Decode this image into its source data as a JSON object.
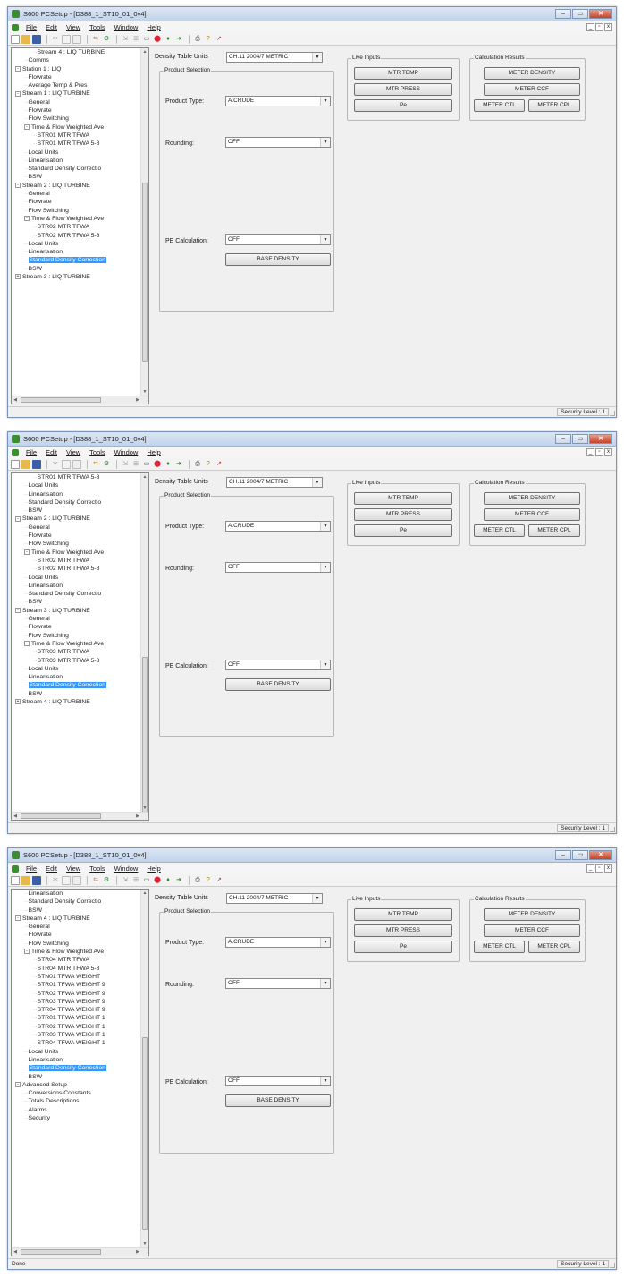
{
  "app": {
    "title": "S600 PCSetup - [D388_1_ST10_01_0v4]",
    "menus": [
      "File",
      "Edit",
      "View",
      "Tools",
      "Window",
      "Help"
    ],
    "caption_buttons": {
      "min": "–",
      "max": "▭",
      "close": "✕"
    },
    "mdi_buttons": {
      "min": "_",
      "restore": "▫",
      "close": "x"
    }
  },
  "form": {
    "density_table_units_label": "Density Table Units",
    "density_table_units_value": "CH.11 2004/7 METRIC",
    "product_selection_label": "Product Selection",
    "product_type_label": "Product Type:",
    "product_type_value": "A.CRUDE",
    "rounding_label": "Rounding:",
    "rounding_value": "OFF",
    "pe_calc_label": "PE Calculation:",
    "pe_calc_value": "OFF",
    "base_density_button": "BASE DENSITY",
    "live_inputs_label": "Live Inputs",
    "mtr_temp": "MTR TEMP",
    "mtr_press": "MTR PRESS",
    "pe": "Pe",
    "calc_results_label": "Calculation Results",
    "meter_density": "METER DENSITY",
    "meter_ccf": "METER CCF",
    "meter_ctl": "METER CTL",
    "meter_cpl": "METER CPL"
  },
  "status": {
    "security": "Security Level : 1",
    "done": "Done"
  },
  "panels": [
    {
      "tree": [
        {
          "t": "Stream 4 : LIQ TURBINE",
          "lvl": 2
        },
        {
          "t": "Comms",
          "lvl": 1
        },
        {
          "t": "Station 1 : LIQ",
          "lvl": 0,
          "exp": "-"
        },
        {
          "t": "Flowrate",
          "lvl": 1
        },
        {
          "t": "Average Temp & Pres",
          "lvl": 1
        },
        {
          "t": "Stream 1 : LIQ TURBINE",
          "lvl": 0,
          "exp": "-"
        },
        {
          "t": "General",
          "lvl": 1
        },
        {
          "t": "Flowrate",
          "lvl": 1
        },
        {
          "t": "Flow Switching",
          "lvl": 1
        },
        {
          "t": "Time & Flow Weighted Ave",
          "lvl": 1,
          "exp": "-"
        },
        {
          "t": "STR01 MTR TFWA",
          "lvl": 2
        },
        {
          "t": "STR01 MTR TFWA 5-8",
          "lvl": 2
        },
        {
          "t": "Local Units",
          "lvl": 1
        },
        {
          "t": "Linearisation",
          "lvl": 1
        },
        {
          "t": "Standard Density Correctio",
          "lvl": 1
        },
        {
          "t": "BSW",
          "lvl": 1
        },
        {
          "t": "Stream 2 : LIQ TURBINE",
          "lvl": 0,
          "exp": "-"
        },
        {
          "t": "General",
          "lvl": 1
        },
        {
          "t": "Flowrate",
          "lvl": 1
        },
        {
          "t": "Flow Switching",
          "lvl": 1
        },
        {
          "t": "Time & Flow Weighted Ave",
          "lvl": 1,
          "exp": "-"
        },
        {
          "t": "STR02 MTR TFWA",
          "lvl": 2
        },
        {
          "t": "STR02 MTR TFWA 5-8",
          "lvl": 2
        },
        {
          "t": "Local Units",
          "lvl": 1
        },
        {
          "t": "Linearisation",
          "lvl": 1
        },
        {
          "t": "Standard Density Correction",
          "lvl": 1,
          "sel": true
        },
        {
          "t": "BSW",
          "lvl": 1
        },
        {
          "t": "Stream 3 : LIQ TURBINE",
          "lvl": 0,
          "exp": "+"
        }
      ]
    },
    {
      "tree": [
        {
          "t": "STR01 MTR TFWA 5-8",
          "lvl": 2
        },
        {
          "t": "Local Units",
          "lvl": 1
        },
        {
          "t": "Linearisation",
          "lvl": 1
        },
        {
          "t": "Standard Density Correctio",
          "lvl": 1
        },
        {
          "t": "BSW",
          "lvl": 1
        },
        {
          "t": "Stream 2 : LIQ TURBINE",
          "lvl": 0,
          "exp": "-"
        },
        {
          "t": "General",
          "lvl": 1
        },
        {
          "t": "Flowrate",
          "lvl": 1
        },
        {
          "t": "Flow Switching",
          "lvl": 1
        },
        {
          "t": "Time & Flow Weighted Ave",
          "lvl": 1,
          "exp": "-"
        },
        {
          "t": "STR02 MTR TFWA",
          "lvl": 2
        },
        {
          "t": "STR02 MTR TFWA 5-8",
          "lvl": 2
        },
        {
          "t": "Local Units",
          "lvl": 1
        },
        {
          "t": "Linearisation",
          "lvl": 1
        },
        {
          "t": "Standard Density Correctio",
          "lvl": 1
        },
        {
          "t": "BSW",
          "lvl": 1
        },
        {
          "t": "Stream 3 : LIQ TURBINE",
          "lvl": 0,
          "exp": "-"
        },
        {
          "t": "General",
          "lvl": 1
        },
        {
          "t": "Flowrate",
          "lvl": 1
        },
        {
          "t": "Flow Switching",
          "lvl": 1
        },
        {
          "t": "Time & Flow Weighted Ave",
          "lvl": 1,
          "exp": "-"
        },
        {
          "t": "STR03 MTR TFWA",
          "lvl": 2
        },
        {
          "t": "STR03 MTR TFWA 5-8",
          "lvl": 2
        },
        {
          "t": "Local Units",
          "lvl": 1
        },
        {
          "t": "Linearisation",
          "lvl": 1
        },
        {
          "t": "Standard Density Correction",
          "lvl": 1,
          "sel": true
        },
        {
          "t": "BSW",
          "lvl": 1
        },
        {
          "t": "Stream 4 : LIQ TURBINE",
          "lvl": 0,
          "exp": "+"
        }
      ]
    },
    {
      "tree": [
        {
          "t": "Linearisation",
          "lvl": 1
        },
        {
          "t": "Standard Density Correctio",
          "lvl": 1
        },
        {
          "t": "BSW",
          "lvl": 1
        },
        {
          "t": "Stream 4 : LIQ TURBINE",
          "lvl": 0,
          "exp": "-"
        },
        {
          "t": "General",
          "lvl": 1
        },
        {
          "t": "Flowrate",
          "lvl": 1
        },
        {
          "t": "Flow Switching",
          "lvl": 1
        },
        {
          "t": "Time & Flow Weighted Ave",
          "lvl": 1,
          "exp": "-"
        },
        {
          "t": "STR04 MTR TFWA",
          "lvl": 2
        },
        {
          "t": "STR04 MTR TFWA 5-8",
          "lvl": 2
        },
        {
          "t": "STN01 TFWA WEIGHT",
          "lvl": 2
        },
        {
          "t": "STR01 TFWA WEIGHT 9",
          "lvl": 2
        },
        {
          "t": "STR02 TFWA WEIGHT 9",
          "lvl": 2
        },
        {
          "t": "STR03 TFWA WEIGHT 9",
          "lvl": 2
        },
        {
          "t": "STR04 TFWA WEIGHT 9",
          "lvl": 2
        },
        {
          "t": "STR01 TFWA WEIGHT 1",
          "lvl": 2
        },
        {
          "t": "STR02 TFWA WEIGHT 1",
          "lvl": 2
        },
        {
          "t": "STR03 TFWA WEIGHT 1",
          "lvl": 2
        },
        {
          "t": "STR04 TFWA WEIGHT 1",
          "lvl": 2
        },
        {
          "t": "Local Units",
          "lvl": 1
        },
        {
          "t": "Linearisation",
          "lvl": 1
        },
        {
          "t": "Standard Density Correction",
          "lvl": 1,
          "sel": true
        },
        {
          "t": "BSW",
          "lvl": 1
        },
        {
          "t": "Advanced Setup",
          "lvl": 0,
          "exp": "-"
        },
        {
          "t": "Conversions/Constants",
          "lvl": 1
        },
        {
          "t": "Totals Descriptions",
          "lvl": 1
        },
        {
          "t": "Alarms",
          "lvl": 1
        },
        {
          "t": "Security",
          "lvl": 1
        }
      ]
    }
  ]
}
